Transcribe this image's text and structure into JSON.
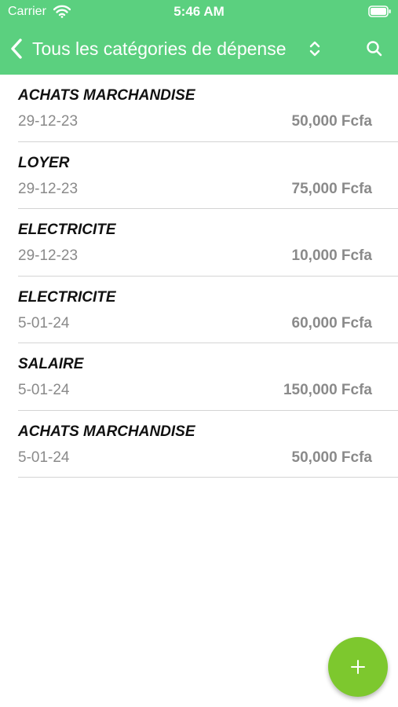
{
  "status_bar": {
    "carrier": "Carrier",
    "time": "5:46 AM"
  },
  "nav": {
    "title": "Tous les catégories de dépense",
    "back_icon": "chevron-left-icon",
    "sort_icon": "chevron-up-down-icon",
    "search_icon": "search-icon"
  },
  "expenses": [
    {
      "category": "ACHATS MARCHANDISE",
      "date": "29-12-23",
      "amount": "50,000 Fcfa"
    },
    {
      "category": "LOYER",
      "date": "29-12-23",
      "amount": "75,000 Fcfa"
    },
    {
      "category": "ELECTRICITE",
      "date": "29-12-23",
      "amount": "10,000 Fcfa"
    },
    {
      "category": "ELECTRICITE",
      "date": "5-01-24",
      "amount": "60,000 Fcfa"
    },
    {
      "category": "SALAIRE",
      "date": "5-01-24",
      "amount": "150,000 Fcfa"
    },
    {
      "category": "ACHATS MARCHANDISE",
      "date": "5-01-24",
      "amount": "50,000 Fcfa"
    }
  ],
  "fab": {
    "icon": "plus-icon"
  },
  "colors": {
    "header": "#5bd07f",
    "fab": "#7dc82e",
    "secondary_text": "#8a8a8a",
    "divider": "#d4d4d4"
  }
}
